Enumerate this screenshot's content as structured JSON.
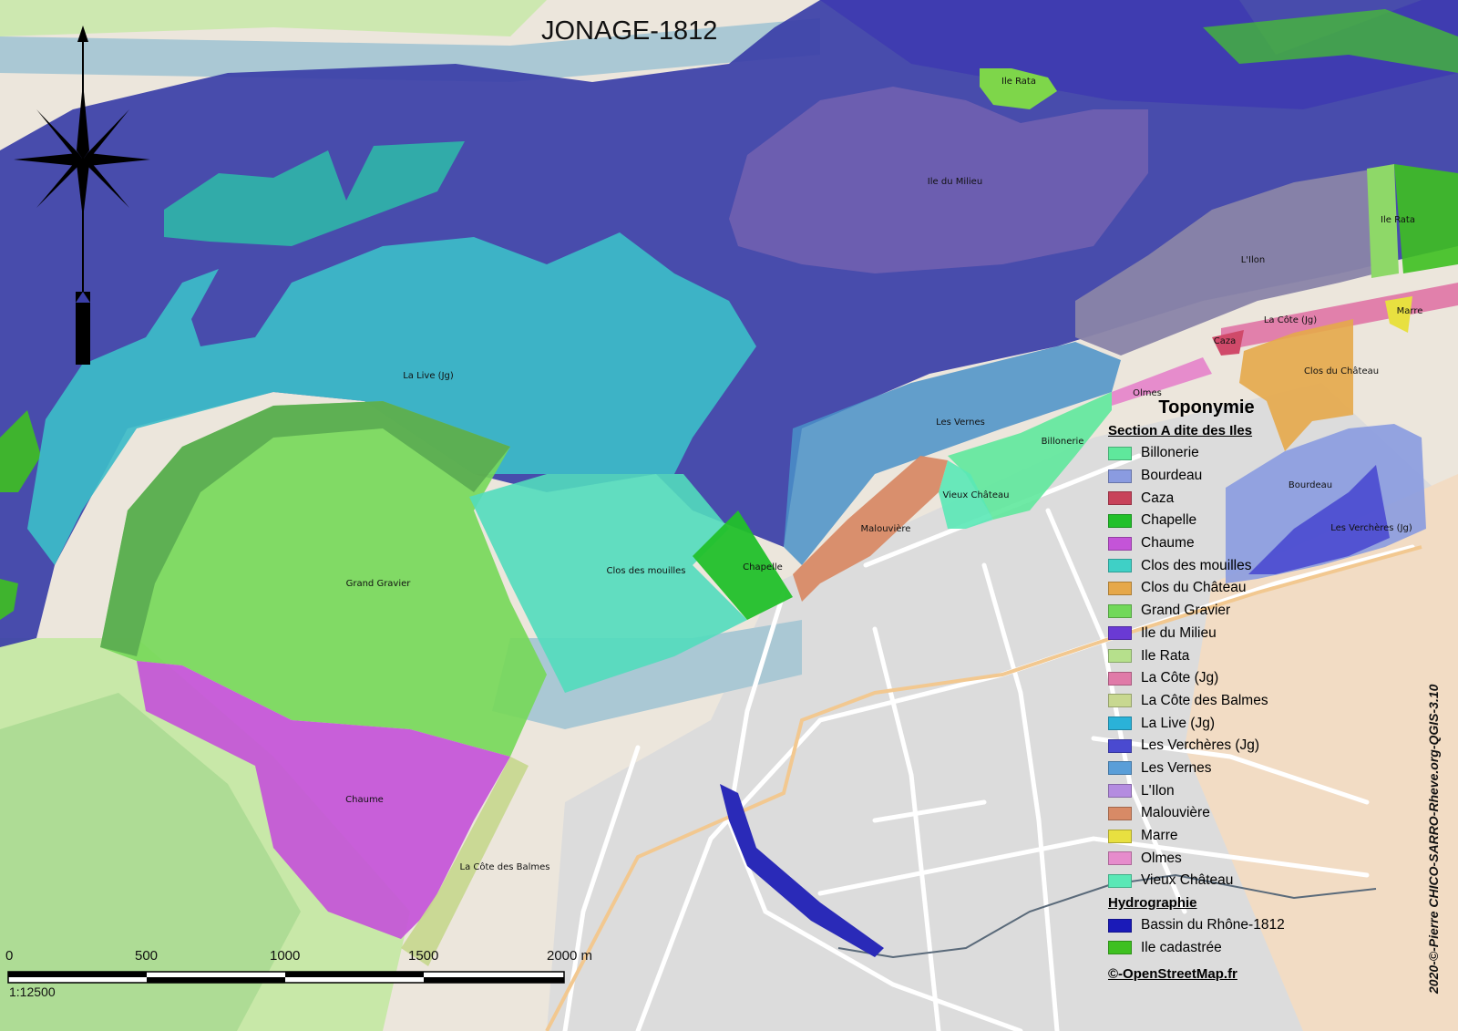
{
  "map": {
    "title": "JONAGE-1812",
    "credit": "2020-©-Pierre CHICO-SARRO-Rheve.org-QGIS-3.10",
    "scale": {
      "ticks": [
        "0",
        "500",
        "1000",
        "1500",
        "2000 m"
      ],
      "ratio": "1:12500"
    },
    "labels": {
      "ile_rata": "Ile Rata",
      "ile_du_milieu": "Ile du Milieu",
      "ile_rata_2": "Ile Rata",
      "ilon": "L'Ilon",
      "marre": "Marre",
      "la_cote": "La Côte (Jg)",
      "caza": "Caza",
      "clos_du_chateau": "Clos du Château",
      "olmes": "Olmes",
      "les_vernes": "Les Vernes",
      "billonerie": "Billonerie",
      "bourdeau": "Bourdeau",
      "les_vercheres": "Les Verchères (Jg)",
      "vieux_chateau": "Vieux Château",
      "malouviere": "Malouvière",
      "la_live": "La Live (Jg)",
      "clos_des_mouilles": "Clos des mouilles",
      "chapelle": "Chapelle",
      "grand_gravier": "Grand Gravier",
      "chaume": "Chaume",
      "la_cote_des_balmes": "La Côte des Balmes"
    }
  },
  "legend": {
    "title": "Toponymie",
    "section_heading": "Section A dite des Iles",
    "section_items": [
      {
        "label": "Billonerie",
        "color": "#5fe89c"
      },
      {
        "label": "Bourdeau",
        "color": "#8a9be0"
      },
      {
        "label": "Caza",
        "color": "#c8425a"
      },
      {
        "label": "Chapelle",
        "color": "#22c02a"
      },
      {
        "label": "Chaume",
        "color": "#c454d8"
      },
      {
        "label": "Clos des mouilles",
        "color": "#3fd0c6"
      },
      {
        "label": "Clos du Château",
        "color": "#e6a84a"
      },
      {
        "label": "Grand Gravier",
        "color": "#72d85a"
      },
      {
        "label": "Ile du Milieu",
        "color": "#6a3ad4"
      },
      {
        "label": "Ile Rata",
        "color": "#b6e08c"
      },
      {
        "label": "La Côte (Jg)",
        "color": "#e07aa8"
      },
      {
        "label": "La Côte des Balmes",
        "color": "#c8d890"
      },
      {
        "label": "La Live (Jg)",
        "color": "#2ab2d8"
      },
      {
        "label": "Les Verchères (Jg)",
        "color": "#4a4ad0"
      },
      {
        "label": "Les Vernes",
        "color": "#5a9ed8"
      },
      {
        "label": "L'Ilon",
        "color": "#b48ce0"
      },
      {
        "label": "Malouvière",
        "color": "#d88a66"
      },
      {
        "label": "Marre",
        "color": "#e8e040"
      },
      {
        "label": "Olmes",
        "color": "#e68ccc"
      },
      {
        "label": "Vieux Château",
        "color": "#5ae8b6"
      }
    ],
    "hydro_heading": "Hydrographie",
    "hydro_items": [
      {
        "label": "Bassin du Rhône-1812",
        "color": "#1a1ab8"
      },
      {
        "label": "Ile cadastrée",
        "color": "#3ec020"
      }
    ],
    "source": "©-OpenStreetMap.fr"
  }
}
